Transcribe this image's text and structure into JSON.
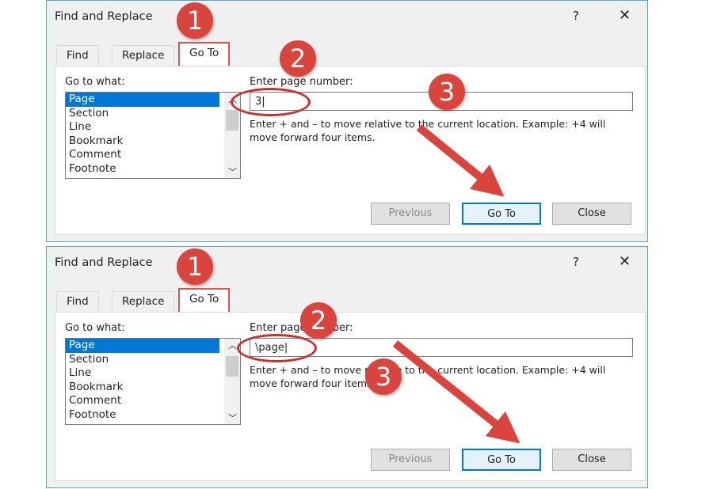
{
  "dialogs": [
    {
      "title": "Find and Replace",
      "help": "?",
      "close": "✕",
      "tabs": [
        "Find",
        "Replace",
        "Go To"
      ],
      "active_tab": "Go To",
      "goto_label": "Go to what:",
      "list": [
        "Page",
        "Section",
        "Line",
        "Bookmark",
        "Comment",
        "Footnote"
      ],
      "selected": "Page",
      "input_label": "Enter page number:",
      "input_value": "3",
      "hint": "Enter + and – to move relative to the current location. Example: +4 will move forward four items.",
      "buttons": {
        "previous": "Previous",
        "goto": "Go To",
        "close": "Close"
      },
      "steps": [
        "1",
        "2",
        "3"
      ]
    },
    {
      "title": "Find and Replace",
      "help": "?",
      "close": "✕",
      "tabs": [
        "Find",
        "Replace",
        "Go To"
      ],
      "active_tab": "Go To",
      "goto_label": "Go to what:",
      "list": [
        "Page",
        "Section",
        "Line",
        "Bookmark",
        "Comment",
        "Footnote"
      ],
      "selected": "Page",
      "input_label": "Enter page number:",
      "input_value": "\\page",
      "hint": "Enter + and – to move relative to the current location. Example: +4 will move forward four items.",
      "buttons": {
        "previous": "Previous",
        "goto": "Go To",
        "close": "Close"
      },
      "steps": [
        "1",
        "2",
        "3"
      ]
    }
  ],
  "colors": {
    "annotation": "#d9453d",
    "selection": "#0078d7",
    "border": "#5aa8c8"
  }
}
